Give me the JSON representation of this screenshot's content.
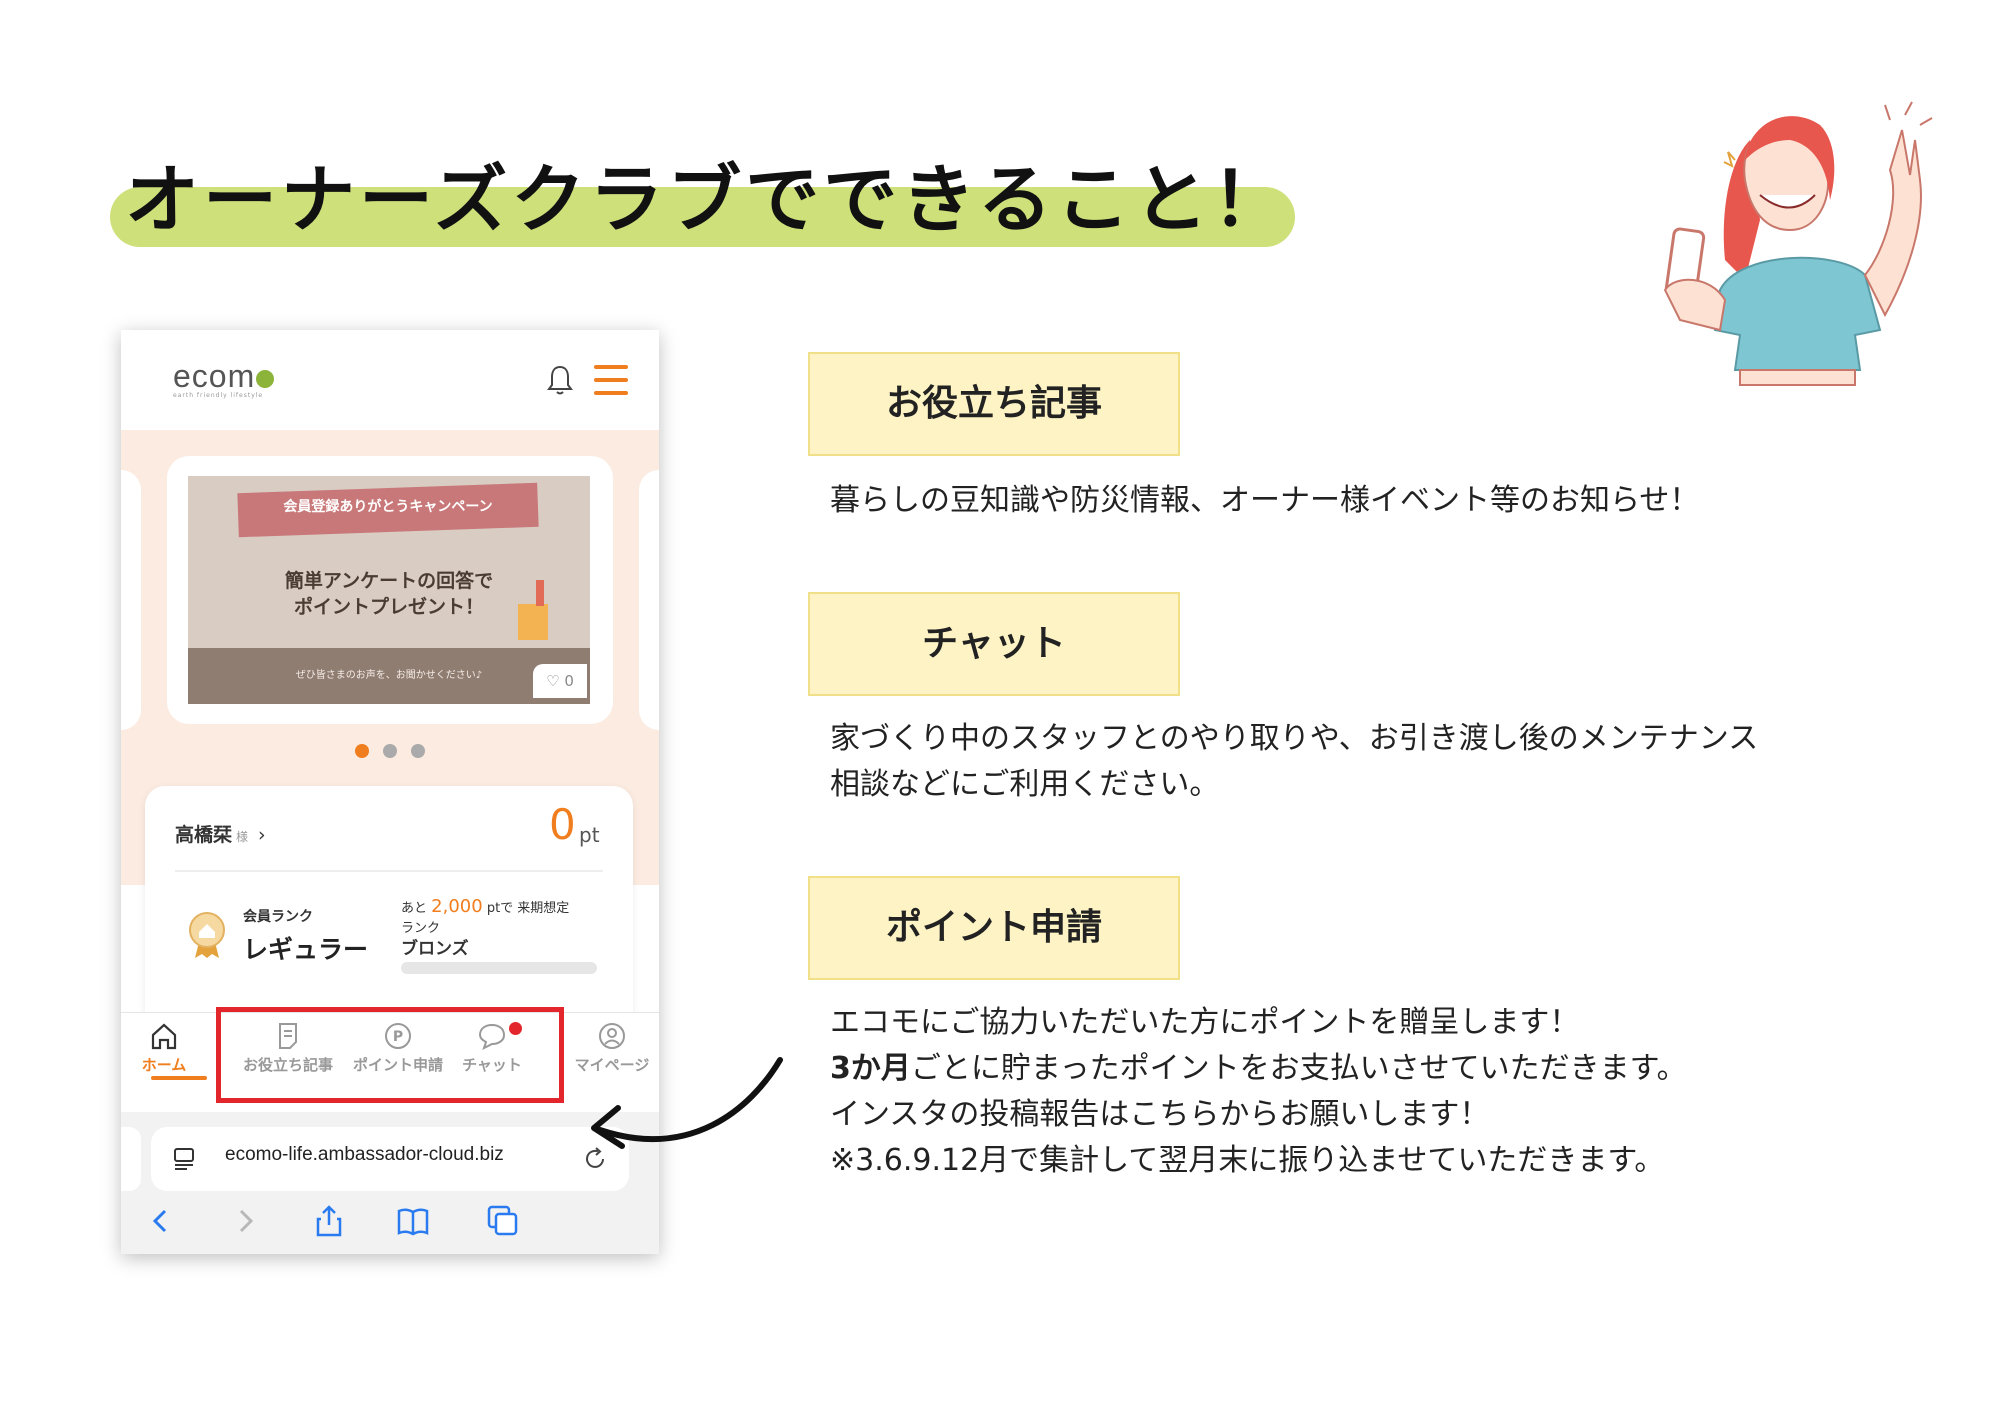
{
  "page": {
    "title": "オーナーズクラブでできること！"
  },
  "phone": {
    "header": {
      "logo": "ecom",
      "logo_sub": "earth friendly lifestyle",
      "bell_icon": "bell-icon",
      "menu_icon": "hamburger-menu-icon"
    },
    "banner": {
      "ribbon": "会員登録ありがとうキャンペーン",
      "line1": "簡単アンケートの回答で",
      "line2": "ポイントプレゼント！",
      "note": "ぜひ皆さまのお声を、お聞かせください♪",
      "likes": "0"
    },
    "carousel": {
      "active_index": 0,
      "count": 3,
      "active_color": "#f07e1f"
    },
    "user": {
      "name": "高橋栞",
      "honorific": "様",
      "points": "0",
      "points_unit": "pt",
      "rank_label": "会員ランク",
      "rank_value": "レギュラー",
      "next_prefix": "あと",
      "next_points": "2,000",
      "next_suffix": "ptで 来期想定",
      "next_rank_word": "ランク",
      "next_rank": "ブロンズ",
      "progress": 0
    },
    "nav": {
      "home": "ホーム",
      "articles": "お役立ち記事",
      "points": "ポイント申請",
      "chat": "チャット",
      "mypage": "マイページ"
    },
    "browser": {
      "url": "ecomo-life.ambassador-cloud.biz"
    }
  },
  "features": [
    {
      "label": "お役立ち記事",
      "lines": [
        "暮らしの豆知識や防災情報、オーナー様イベント等のお知らせ！"
      ]
    },
    {
      "label": "チャット",
      "lines": [
        "家づくり中のスタッフとのやり取りや、お引き渡し後のメンテナンス",
        "相談などにご利用ください。"
      ]
    },
    {
      "label": "ポイント申請",
      "lines": [
        "エコモにご協力いただいた方にポイントを贈呈します！",
        "ごとに貯まったポイントをお支払いさせていただきます。",
        "インスタの投稿報告はこちらからお願いします！",
        "※3.6.9.12月で集計して翌月末に振り込ませていただきます。"
      ],
      "bold_prefix": "3か月"
    }
  ],
  "colors": {
    "accent": "#f07e1f",
    "title_bar": "#cde07a",
    "label_box": "#fdf3c4",
    "highlight": "#e3262b"
  }
}
